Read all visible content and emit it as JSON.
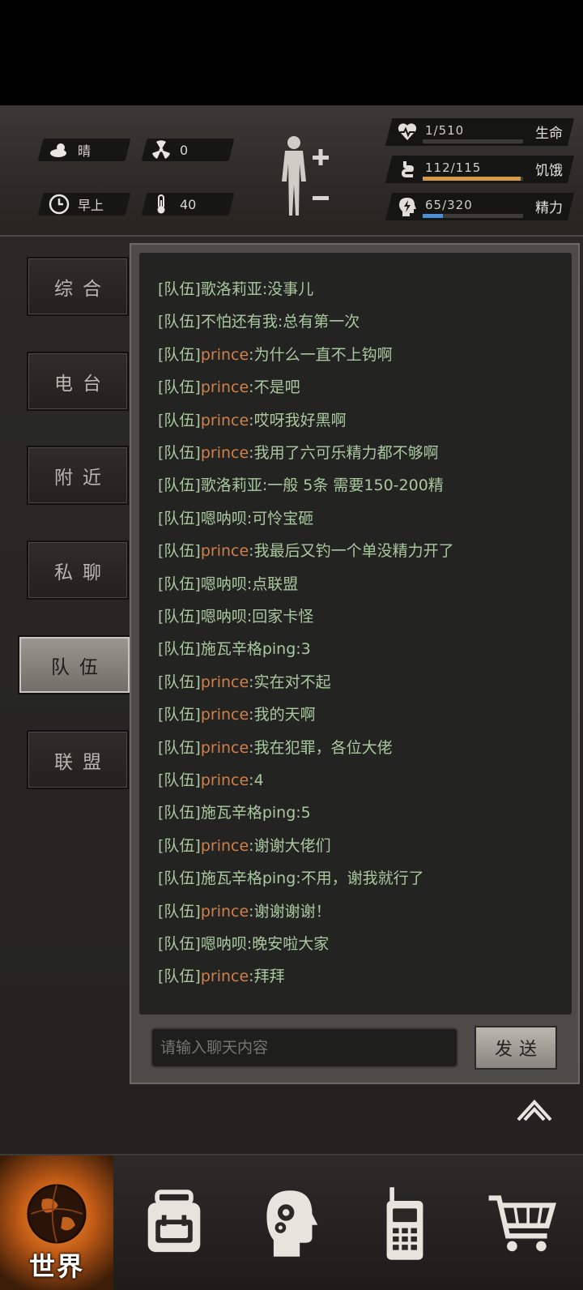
{
  "hud": {
    "weather": "晴",
    "radiation": "0",
    "time_of_day": "早上",
    "temperature": "40",
    "stats": [
      {
        "name": "生命",
        "value": "1/510",
        "fraction": 0.002,
        "color": "#3b3a37",
        "icon": "heart-pulse-icon"
      },
      {
        "name": "饥饿",
        "value": "112/115",
        "fraction": 0.974,
        "color": "#d49a4a",
        "icon": "stomach-icon"
      },
      {
        "name": "精力",
        "value": "65/320",
        "fraction": 0.203,
        "color": "#4d8fd6",
        "icon": "energy-head-icon"
      }
    ]
  },
  "tabs": [
    {
      "label": "综合",
      "active": false
    },
    {
      "label": "电台",
      "active": false
    },
    {
      "label": "附近",
      "active": false
    },
    {
      "label": "私聊",
      "active": false
    },
    {
      "label": "队伍",
      "active": true
    },
    {
      "label": "联盟",
      "active": false
    }
  ],
  "chat": {
    "messages": [
      {
        "channel": "[队伍]",
        "sender": "歌洛莉亚",
        "text": ":没事儿",
        "orange": false
      },
      {
        "channel": "[队伍]",
        "sender": "不怕还有我",
        "text": ":总有第一次",
        "orange": false
      },
      {
        "channel": "[队伍]",
        "sender": "prince",
        "text": ":为什么一直不上钩啊",
        "orange": true
      },
      {
        "channel": "[队伍]",
        "sender": "prince",
        "text": ":不是吧",
        "orange": true
      },
      {
        "channel": "[队伍]",
        "sender": "prince",
        "text": ":哎呀我好黑啊",
        "orange": true
      },
      {
        "channel": "[队伍]",
        "sender": "prince",
        "text": ":我用了六可乐精力都不够啊",
        "orange": true
      },
      {
        "channel": "[队伍]",
        "sender": "歌洛莉亚",
        "text": ":一般 5条 需要150-200精",
        "orange": false
      },
      {
        "channel": "[队伍]",
        "sender": "嗯呐呗",
        "text": ":可怜宝砸",
        "orange": false
      },
      {
        "channel": "[队伍]",
        "sender": "prince",
        "text": ":我最后又钓一个单没精力开了",
        "orange": true
      },
      {
        "channel": "[队伍]",
        "sender": "嗯呐呗",
        "text": ":点联盟",
        "orange": false
      },
      {
        "channel": "[队伍]",
        "sender": "嗯呐呗",
        "text": ":回家卡怪",
        "orange": false
      },
      {
        "channel": "[队伍]",
        "sender": "施瓦辛格ping",
        "text": ":3",
        "orange": false
      },
      {
        "channel": "[队伍]",
        "sender": "prince",
        "text": ":实在对不起",
        "orange": true
      },
      {
        "channel": "[队伍]",
        "sender": "prince",
        "text": ":我的天啊",
        "orange": true
      },
      {
        "channel": "[队伍]",
        "sender": "prince",
        "text": ":我在犯罪，各位大佬",
        "orange": true
      },
      {
        "channel": "[队伍]",
        "sender": "prince",
        "text": ":4",
        "orange": true
      },
      {
        "channel": "[队伍]",
        "sender": "施瓦辛格ping",
        "text": ":5",
        "orange": false
      },
      {
        "channel": "[队伍]",
        "sender": "prince",
        "text": ":谢谢大佬们",
        "orange": true
      },
      {
        "channel": "[队伍]",
        "sender": "施瓦辛格ping",
        "text": ":不用，谢我就行了",
        "orange": false
      },
      {
        "channel": "[队伍]",
        "sender": "prince",
        "text": ":谢谢谢谢！",
        "orange": true
      },
      {
        "channel": "[队伍]",
        "sender": "嗯呐呗",
        "text": ":晚安啦大家",
        "orange": false
      },
      {
        "channel": "[队伍]",
        "sender": "prince",
        "text": ":拜拜",
        "orange": true
      }
    ],
    "input_placeholder": "请输入聊天内容",
    "send_label": "发送"
  },
  "bottom_nav": {
    "world_label": "世界",
    "items": [
      "globe-icon",
      "backpack-icon",
      "skills-head-icon",
      "walkie-talkie-icon",
      "shopping-cart-icon"
    ]
  }
}
